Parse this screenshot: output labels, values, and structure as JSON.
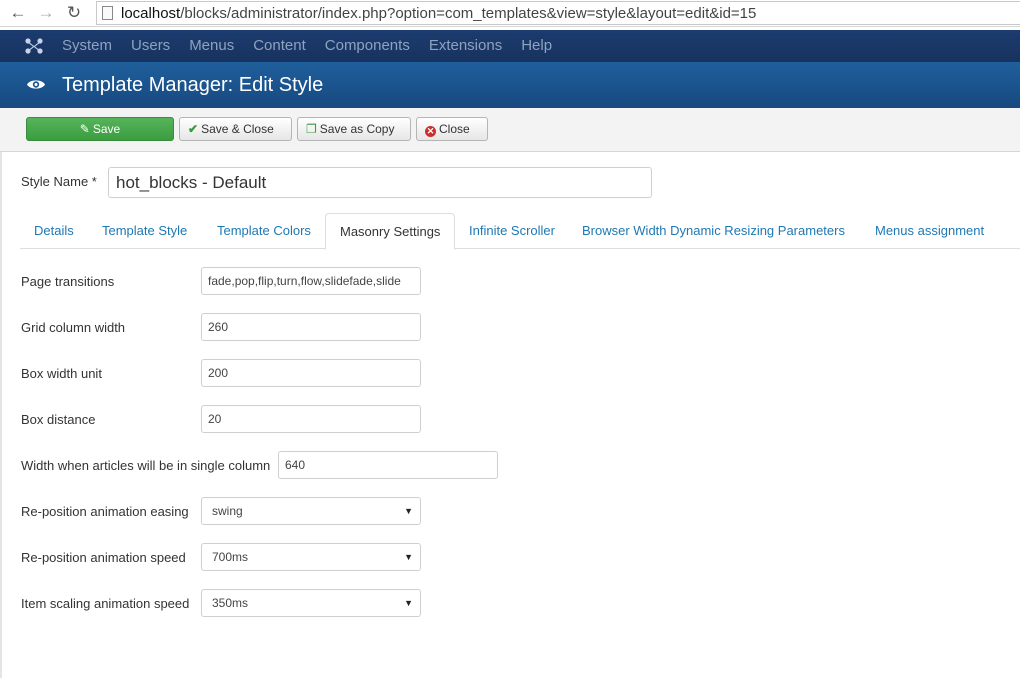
{
  "browser": {
    "url_host": "localhost",
    "url_path": "/blocks/administrator/index.php?option=com_templates&view=style&layout=edit&id=15"
  },
  "admin_menu": [
    "System",
    "Users",
    "Menus",
    "Content",
    "Components",
    "Extensions",
    "Help"
  ],
  "header": {
    "title": "Template Manager: Edit Style"
  },
  "toolbar": {
    "save": "Save",
    "save_close": "Save & Close",
    "save_copy": "Save as Copy",
    "close": "Close"
  },
  "style_name": {
    "label": "Style Name *",
    "value": "hot_blocks - Default"
  },
  "tabs": [
    "Details",
    "Template Style",
    "Template Colors",
    "Masonry Settings",
    "Infinite Scroller",
    "Browser Width Dynamic Resizing Parameters",
    "Menus assignment"
  ],
  "active_tab": "Masonry Settings",
  "fields": {
    "page_transitions": {
      "label": "Page transitions",
      "value": "fade,pop,flip,turn,flow,slidefade,slide"
    },
    "grid_column_width": {
      "label": "Grid column width",
      "value": "260"
    },
    "box_width_unit": {
      "label": "Box width unit",
      "value": "200"
    },
    "box_distance": {
      "label": "Box distance",
      "value": "20"
    },
    "single_column_width": {
      "label": "Width when articles will be in single column",
      "value": "640"
    },
    "reposition_easing": {
      "label": "Re-position animation easing",
      "value": "swing"
    },
    "reposition_speed": {
      "label": "Re-position animation speed",
      "value": "700ms"
    },
    "item_scaling_speed": {
      "label": "Item scaling animation speed",
      "value": "350ms"
    }
  },
  "colors": {
    "navbar": "#1a3867",
    "header": "#1c5791",
    "save_green": "#46a74b",
    "link_blue": "#1f78b4"
  }
}
